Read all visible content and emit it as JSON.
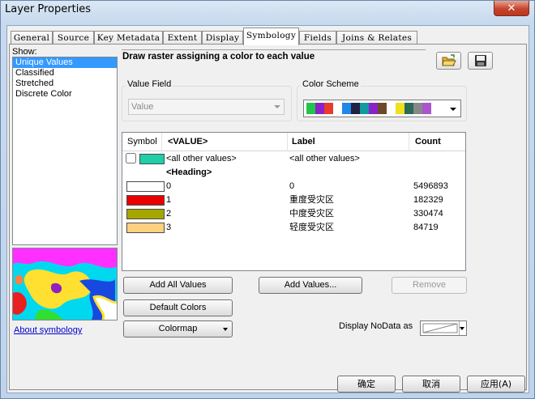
{
  "window": {
    "title": "Layer Properties",
    "close_glyph": "✕"
  },
  "tabs": [
    {
      "label": "General"
    },
    {
      "label": "Source"
    },
    {
      "label": "Key Metadata"
    },
    {
      "label": "Extent"
    },
    {
      "label": "Display"
    },
    {
      "label": "Symbology",
      "active": true
    },
    {
      "label": "Fields"
    },
    {
      "label": "Joins & Relates"
    }
  ],
  "show": {
    "label": "Show:",
    "items": [
      "Unique Values",
      "Classified",
      "Stretched",
      "Discrete Color"
    ],
    "selected": "Unique Values",
    "about_link": "About symbology"
  },
  "description": "Draw raster assigning a color to each value",
  "value_field": {
    "label": "Value Field",
    "value": "Value"
  },
  "color_scheme": {
    "label": "Color Scheme",
    "swatches": [
      "#22c44b",
      "#8a22c8",
      "#e83b2c",
      "#ffffff",
      "#1f88e8",
      "#222244",
      "#119aa0",
      "#8a22c8",
      "#6b4a2a",
      "#ffffff",
      "#f0e020",
      "#2a6b55",
      "#888888",
      "#aa55cc"
    ]
  },
  "table": {
    "headers": {
      "symbol": "Symbol",
      "value": "<VALUE>",
      "label": "Label",
      "count": "Count"
    },
    "all_other": {
      "value": "<all other values>",
      "label": "<all other values>",
      "color": "#1ecfa8"
    },
    "heading": "<Heading>",
    "rows": [
      {
        "value": "0",
        "label": "0",
        "count": "5496893",
        "color": "#ffffff"
      },
      {
        "value": "1",
        "label": "重度受灾区",
        "count": "182329",
        "color": "#e80000"
      },
      {
        "value": "2",
        "label": "中度受灾区",
        "count": "330474",
        "color": "#a6a600"
      },
      {
        "value": "3",
        "label": "轻度受灾区",
        "count": "84719",
        "color": "#ffd080"
      }
    ]
  },
  "buttons": {
    "add_all": "Add All Values",
    "add_values": "Add Values...",
    "remove": "Remove",
    "default_colors": "Default Colors",
    "colormap": "Colormap"
  },
  "nodata": {
    "label": "Display NoData as"
  },
  "dialog_buttons": {
    "ok": "确定",
    "cancel": "取消",
    "apply": "应用(A)"
  },
  "colors": {
    "selection": "#3399ff",
    "link": "#0000cc"
  }
}
